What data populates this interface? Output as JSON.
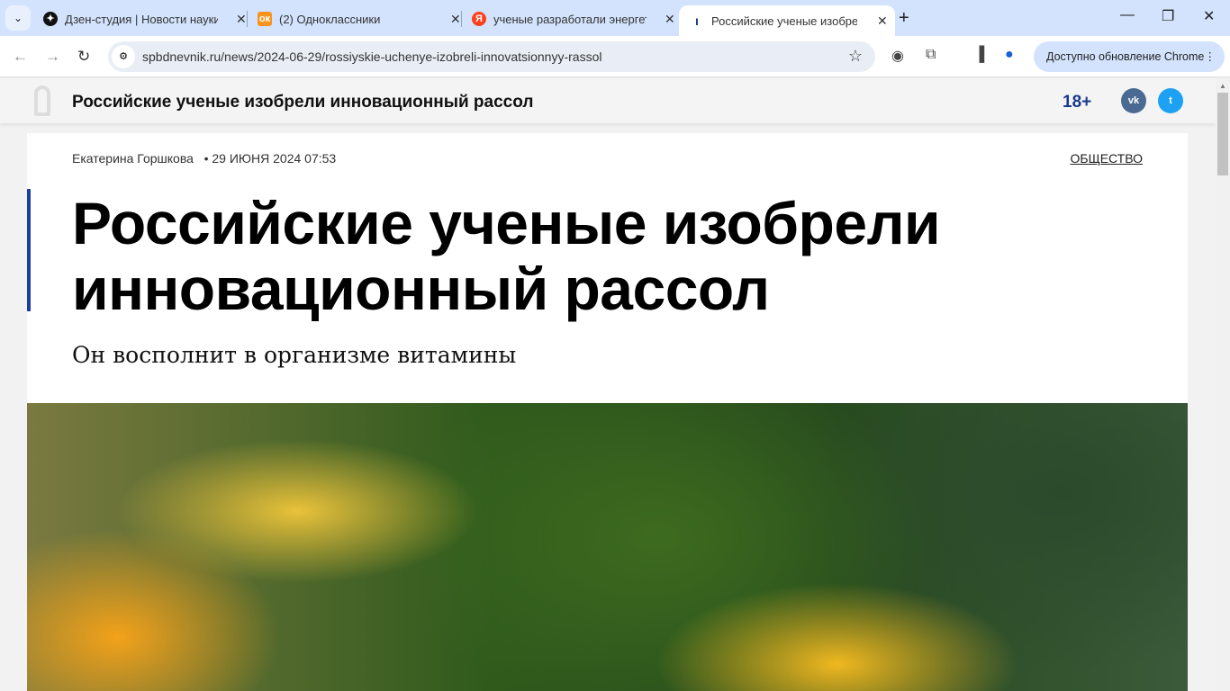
{
  "tabs": [
    {
      "title": "Дзен-студия | Новости науки: ...",
      "color": "#111111",
      "glyph": "✦"
    },
    {
      "title": "(2) Одноклассники",
      "color": "#f7931e",
      "glyph": "ок"
    },
    {
      "title": "ученые разработали энергетически...",
      "color": "#fc3f1d",
      "glyph": "Я"
    },
    {
      "title": "Российские ученые изобрели",
      "color": "#1b3a8c",
      "glyph": "|"
    }
  ],
  "browser": {
    "url": "spbdnevnik.ru/news/2024-06-29/rossiyskie-uchenye-izobreli-innovatsionnyy-rassol",
    "update_label": "Доступно обновление Chrome"
  },
  "header": {
    "title": "Российские ученые изобрели инновационный рассол",
    "age": "18+",
    "vk": "vk",
    "tw": "t"
  },
  "article": {
    "author": "Екатерина Горшкова",
    "date": "• 29 ИЮНЯ 2024 07:53",
    "category": "ОБЩЕСТВО",
    "title": "Российские ученые изобрели инновационный рассол",
    "subtitle": "Он восполнит в организме витамины"
  }
}
